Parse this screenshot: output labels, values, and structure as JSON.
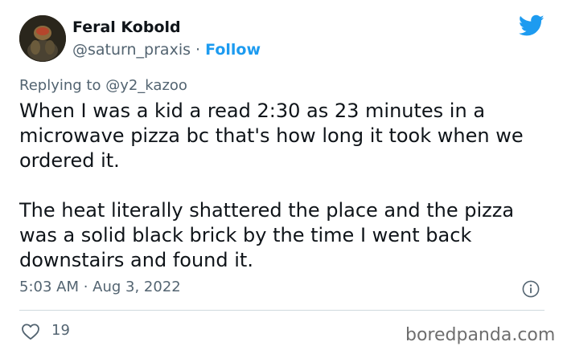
{
  "author": {
    "display_name": "Feral Kobold",
    "handle": "@saturn_praxis",
    "separator": " · ",
    "follow_label": "Follow"
  },
  "reply": {
    "prefix": "Replying to ",
    "handle": "@y2_kazoo"
  },
  "tweet": {
    "paragraphs": [
      "When I was a kid a read 2:30 as 23 minutes in a microwave pizza bc that's how long it took when we ordered it.",
      "The heat literally shattered the place and the pizza was a solid black brick by the time I went back downstairs and found it."
    ],
    "timestamp": "5:03 AM · Aug 3, 2022"
  },
  "stats": {
    "likes": "19"
  },
  "watermark": "boredpanda.com",
  "colors": {
    "accent": "#1d9bf0",
    "secondary_text": "#536471",
    "divider": "#cfd9de"
  },
  "icons": [
    "twitter-bird-icon",
    "info-icon",
    "heart-icon"
  ]
}
